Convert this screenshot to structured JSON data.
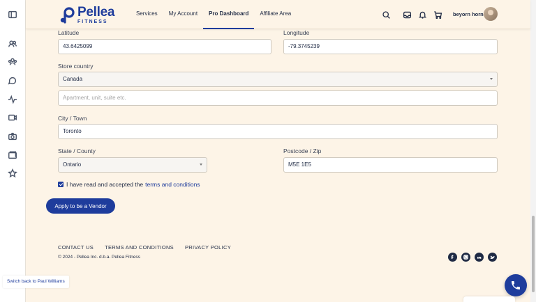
{
  "brand": {
    "name": "Pellea",
    "sub": "FITNESS",
    "color": "#1e3c9c"
  },
  "nav": {
    "items": [
      {
        "label": "Services"
      },
      {
        "label": "My Account"
      },
      {
        "label": "Pro Dashboard",
        "active": true
      },
      {
        "label": "Affiliate Area"
      }
    ]
  },
  "header_icons": [
    "search-icon",
    "inbox-icon",
    "bell-icon",
    "cart-icon"
  ],
  "user": {
    "name": "beyorn horn"
  },
  "sidebar_icons": [
    "sidebar-toggle-icon",
    "users-icon",
    "group-icon",
    "chat-icon",
    "activity-icon",
    "video-icon",
    "camera-icon",
    "folder-icon",
    "star-icon"
  ],
  "form": {
    "latitude": {
      "label": "Latitude",
      "value": "43.6425099"
    },
    "longitude": {
      "label": "Longitude",
      "value": "-79.3745239"
    },
    "country": {
      "label": "Store country",
      "value": "Canada"
    },
    "address2": {
      "placeholder": "Apartment, unit, suite etc."
    },
    "city": {
      "label": "City / Town",
      "value": "Toronto"
    },
    "state": {
      "label": "State / County",
      "value": "Ontario"
    },
    "postcode": {
      "label": "Postcode / Zip",
      "value": "M5E 1E5"
    },
    "terms": {
      "text": "I have read and accepted the",
      "link": "terms and conditions",
      "checked": true
    },
    "submit_label": "Apply to be a Vendor"
  },
  "footer": {
    "links": [
      "CONTACT US",
      "TERMS AND CONDITIONS",
      "PRIVACY POLICY"
    ],
    "copyright": "© 2024 - Pellea Inc. d.b.a. Pellea Fitness",
    "social_icons": [
      "facebook-icon",
      "instagram-icon",
      "linkedin-icon",
      "twitter-icon"
    ]
  },
  "switch_back_label": "Switch back to Paul Williams"
}
